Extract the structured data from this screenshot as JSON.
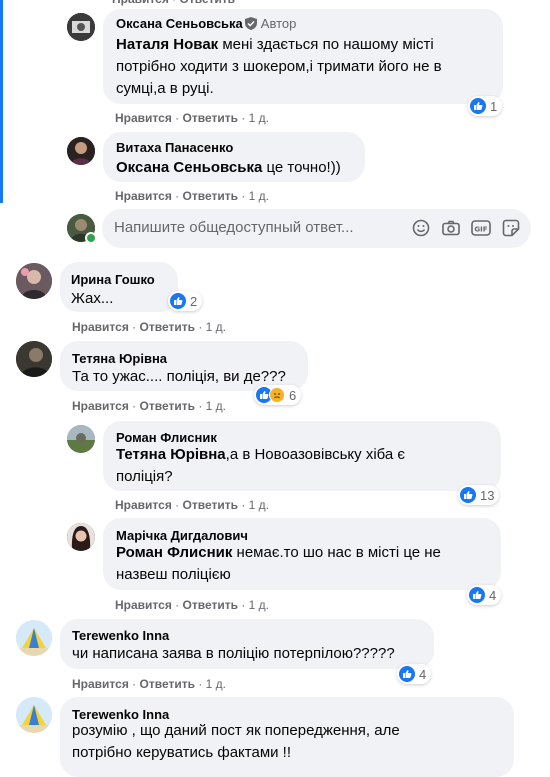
{
  "actions": {
    "like": "Нравится",
    "reply": "Ответить",
    "sep": "·"
  },
  "comments": [
    {
      "author": "Оксана Сеньовська",
      "badge": "Автор",
      "mention": "Наталя Новак",
      "text1": " мені здається по нашому місті",
      "text2": "потрібно ходити з шокером,і тримати його не в",
      "text3": "сумці,а в руці.",
      "time": "1 д.",
      "reactions": "1"
    },
    {
      "author": "Витаха Панасенко",
      "mention": "Оксана Сеньовська",
      "text1": " це точно!))",
      "time": "1 д."
    },
    {
      "author": "Ирина Гошко",
      "text1": "Жах...",
      "time": "1 д.",
      "reactions": "2"
    },
    {
      "author": "Тетяна Юрівна",
      "text1": "Та то ужас.... поліція, ви де???",
      "time": "1 д.",
      "reactions": "6"
    },
    {
      "author": "Роман Флисник",
      "mention": "Тетяна Юрівна",
      "text1": ",а в Новоазовівську хіба є",
      "text2": "поліція?",
      "time": "1 д.",
      "reactions": "13"
    },
    {
      "author": "Марічка Дигдалович",
      "mention": "Роман Флисник",
      "text1": " немає.то шо нас в місті це не",
      "text2": "назвеш поліцією",
      "time": "1 д.",
      "reactions": "4"
    },
    {
      "author": "Terewenko Inna",
      "text1": "чи написана заява в поліцію потерпілою?????",
      "time": "1 д.",
      "reactions": "4"
    },
    {
      "author": "Terewenko Inna",
      "text1": "розумію , що даний пост як попередження, але",
      "text2": "потрібно керуватись фактами !!"
    }
  ],
  "reply_input": {
    "placeholder": "Напишите общедоступный ответ..."
  },
  "colors": {
    "accent": "#1877f2",
    "bubble": "#f0f2f5",
    "muted": "#65676b"
  }
}
